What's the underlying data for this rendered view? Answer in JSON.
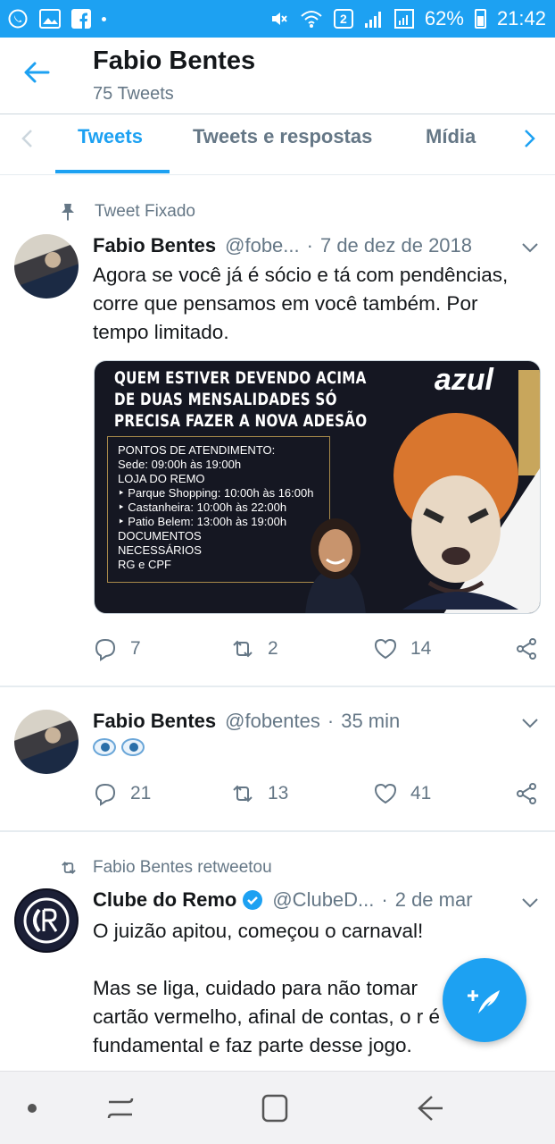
{
  "status_bar": {
    "battery": "62%",
    "time": "21:42",
    "sim_badge": "2",
    "left_icons": [
      "whatsapp-icon",
      "gallery-icon",
      "facebook-icon"
    ],
    "right_icons": [
      "mute-icon",
      "wifi-icon",
      "signal-icon",
      "signal-icon",
      "battery-icon"
    ]
  },
  "header": {
    "title": "Fabio Bentes",
    "subtitle": "75 Tweets"
  },
  "tabs": [
    {
      "label": "Tweets",
      "active": true
    },
    {
      "label": "Tweets e respostas",
      "active": false
    },
    {
      "label": "Mídia",
      "active": false
    }
  ],
  "tweets": [
    {
      "pinned_label": "Tweet Fixado",
      "name": "Fabio Bentes",
      "handle": "@fobe...",
      "time": "7 de dez de 2018",
      "text": "Agora se você já é sócio e tá com pendências,\ncorre que pensamos em você também. Por\ntempo limitado.",
      "media": {
        "headline": "QUEM ESTIVER DEVENDO ACIMA\nDE DUAS MENSALIDADES SÓ\nPRECISA FAZER A NOVA ADESÃO",
        "brand": "azul",
        "info": "PONTOS DE ATENDIMENTO:\nSede: 09:00h às 19:00h\nLOJA DO REMO\n‣ Parque Shopping: 10:00h às 16:00h\n‣ Castanheira: 10:00h às 22:00h\n‣ Patio Belem: 13:00h às 19:00h\nDOCUMENTOS\nNECESSÁRIOS\nRG e CPF"
      },
      "replies": "7",
      "retweets": "2",
      "likes": "14"
    },
    {
      "name": "Fabio Bentes",
      "handle": "@fobentes",
      "time": "35 min",
      "emoji": "eyes-emoji",
      "replies": "21",
      "retweets": "13",
      "likes": "41"
    },
    {
      "retweet_label": "Fabio Bentes retweetou",
      "name": "Clube do Remo",
      "handle": "@ClubeD...",
      "time": "2 de mar",
      "verified": true,
      "text": "O juizão apitou, começou o carnaval!\n\nMas se liga, cuidado para não tomar\ncartão vermelho, afinal de contas, o r      é\nfundamental e faz parte desse jogo."
    }
  ],
  "colors": {
    "accent": "#1da1f2",
    "secondary_text": "#657786",
    "primary_text": "#14171a"
  }
}
